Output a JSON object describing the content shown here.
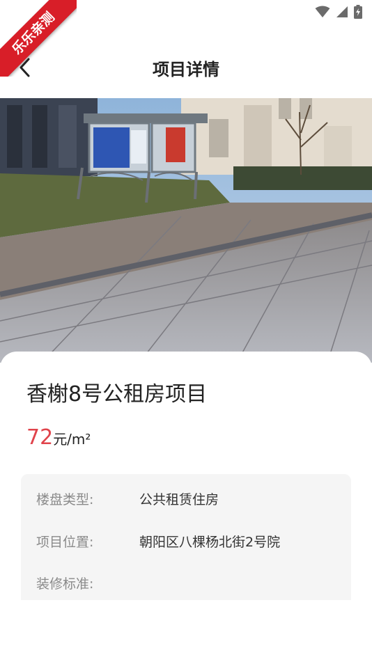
{
  "status_bar": {
    "icons": [
      "wifi-icon",
      "signal-icon",
      "battery-charging-icon"
    ]
  },
  "watermark": {
    "text": "乐乐亲测"
  },
  "header": {
    "back_icon": "chevron-left-icon",
    "title": "项目详情"
  },
  "photo": {
    "description_icon": "project-photo"
  },
  "project": {
    "name": "香榭8号公租房项目",
    "price_value": "72",
    "price_unit": "元/m²",
    "price_color": "#e0434b"
  },
  "details": [
    {
      "label": "楼盘类型:",
      "value": "公共租赁住房"
    },
    {
      "label": "项目位置:",
      "value": "朝阳区八棵杨北街2号院"
    },
    {
      "label": "装修标准:",
      "value": ""
    }
  ]
}
